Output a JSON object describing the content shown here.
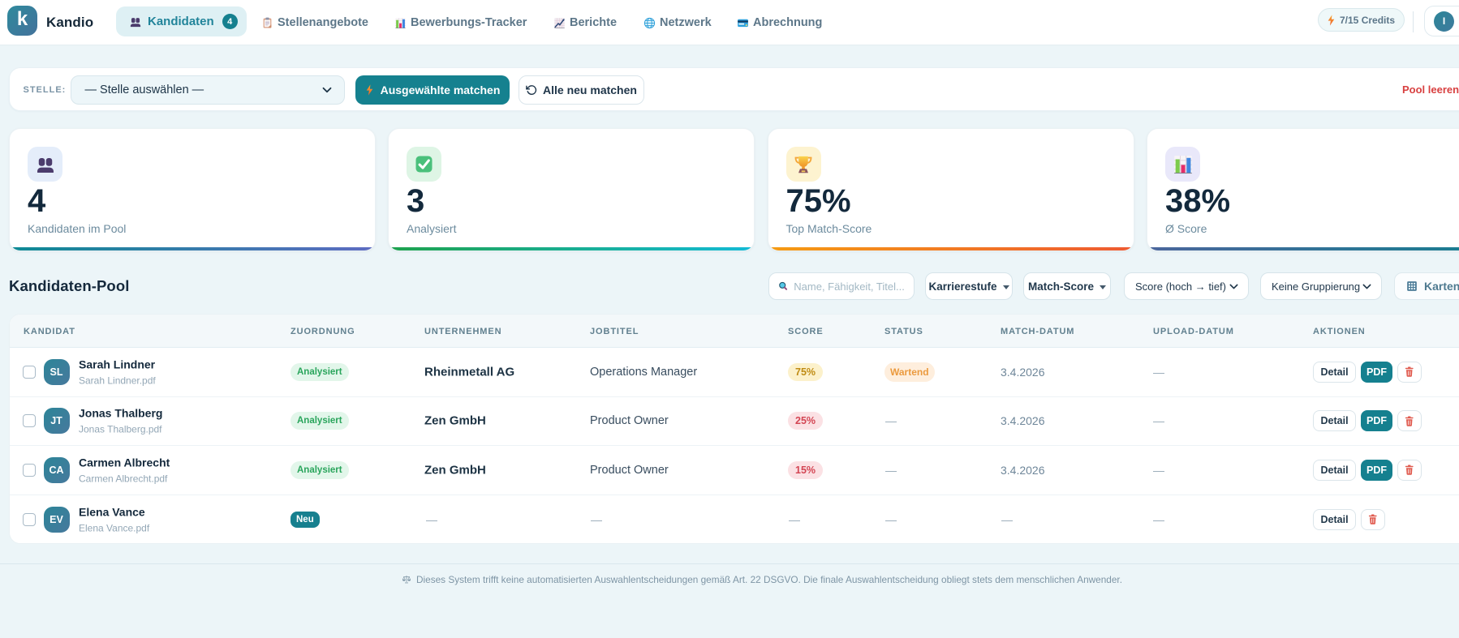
{
  "header": {
    "logo_letter": "k",
    "brand": "Kandio",
    "nav_active": {
      "label": "Kandidaten",
      "badge": "4"
    },
    "nav_items": [
      {
        "label": "Stellenangebote"
      },
      {
        "label": "Bewerbungs-Tracker"
      },
      {
        "label": "Berichte"
      },
      {
        "label": "Netzwerk"
      },
      {
        "label": "Abrechnung"
      }
    ],
    "credits": "7/15 Credits",
    "avatar_initial": "I"
  },
  "toolbar": {
    "stelle_label": "STELLE:",
    "stelle_select_value": "— Stelle auswählen —",
    "match_selected_label": "Ausgewählte matchen",
    "match_all_label": "Alle neu matchen",
    "clear_pool_label": "Pool leeren"
  },
  "stats": [
    {
      "value": "4",
      "label": "Kandidaten im Pool"
    },
    {
      "value": "3",
      "label": "Analysiert"
    },
    {
      "value": "75%",
      "label": "Top Match-Score"
    },
    {
      "value": "38%",
      "label": "Ø Score"
    }
  ],
  "pool": {
    "title": "Kandidaten-Pool",
    "search_placeholder": "Name, Fähigkeit, Titel...",
    "filter_career": "Karrierestufe",
    "filter_score": "Match-Score",
    "sort_value": "Score (hoch → tief)",
    "group_value": "Keine Gruppierung",
    "view_label": "Karten"
  },
  "table": {
    "headers": [
      "KANDIDAT",
      "ZUORDNUNG",
      "UNTERNEHMEN",
      "JOBTITEL",
      "SCORE",
      "STATUS",
      "MATCH-DATUM",
      "UPLOAD-DATUM",
      "AKTIONEN"
    ],
    "empty": "—",
    "detail_label": "Detail",
    "pdf_label": "PDF",
    "rows": [
      {
        "initials": "SL",
        "name": "Sarah Lindner",
        "file": "Sarah Lindner.pdf",
        "tag": "Analysiert",
        "company": "Rheinmetall AG",
        "job": "Operations Manager",
        "score": "75%",
        "status": "Wartend",
        "match_date": "3.4.2026"
      },
      {
        "initials": "JT",
        "name": "Jonas Thalberg",
        "file": "Jonas Thalberg.pdf",
        "tag": "Analysiert",
        "company": "Zen GmbH",
        "job": "Product Owner",
        "score": "25%",
        "status": "—",
        "match_date": "3.4.2026"
      },
      {
        "initials": "CA",
        "name": "Carmen Albrecht",
        "file": "Carmen Albrecht.pdf",
        "tag": "Analysiert",
        "company": "Zen GmbH",
        "job": "Product Owner",
        "score": "15%",
        "status": "—",
        "match_date": "3.4.2026"
      },
      {
        "initials": "EV",
        "name": "Elena Vance",
        "file": "Elena Vance.pdf",
        "tag": "Neu"
      }
    ]
  },
  "footer": {
    "disclaimer": "Dieses System trifft keine automatisierten Auswahlentscheidungen gemäß Art. 22 DSGVO. Die finale Auswahlentscheidung obliegt stets dem menschlichen Anwender."
  }
}
